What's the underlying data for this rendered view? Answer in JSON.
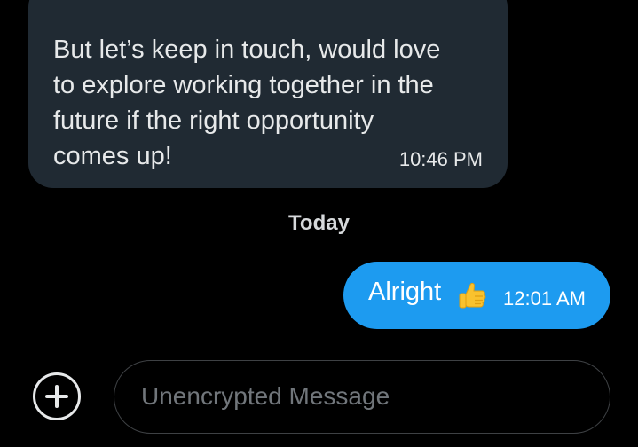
{
  "conversation": {
    "incoming": {
      "text": "But let’s keep in touch, would love\nto explore working together in the\nfuture if the right opportunity\ncomes up!",
      "time": "10:46 PM"
    },
    "day_divider": "Today",
    "outgoing": {
      "text": "Alright",
      "emoji": "thumbs-up-icon",
      "time": "12:01 AM"
    }
  },
  "composer": {
    "add_icon": "plus-circle-icon",
    "placeholder": "Unencrypted Message",
    "value": ""
  },
  "colors": {
    "background": "#000000",
    "incoming_bubble": "#202a33",
    "outgoing_bubble": "#1d9bf0",
    "placeholder": "#71767b"
  }
}
